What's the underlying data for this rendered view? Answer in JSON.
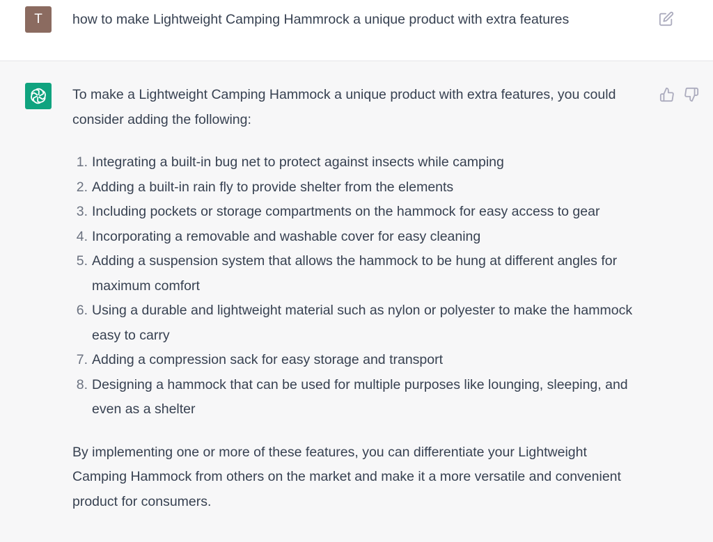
{
  "user_message": {
    "avatar_initial": "T",
    "text": "how to make Lightweight Camping Hammrock a unique product with extra features",
    "edit_icon": "edit-icon"
  },
  "assistant_message": {
    "avatar_icon": "openai-logo-icon",
    "intro": "To make a Lightweight Camping Hammock a unique product with extra features, you could consider adding the following:",
    "items": [
      {
        "number": "1.",
        "text": "Integrating a built-in bug net to protect against insects while camping"
      },
      {
        "number": "2.",
        "text": "Adding a built-in rain fly to provide shelter from the elements"
      },
      {
        "number": "3.",
        "text": "Including pockets or storage compartments on the hammock for easy access to gear"
      },
      {
        "number": "4.",
        "text": "Incorporating a removable and washable cover for easy cleaning"
      },
      {
        "number": "5.",
        "text": "Adding a suspension system that allows the hammock to be hung at different angles for maximum comfort"
      },
      {
        "number": "6.",
        "text": "Using a durable and lightweight material such as nylon or polyester to make the hammock easy to carry"
      },
      {
        "number": "7.",
        "text": "Adding a compression sack for easy storage and transport"
      },
      {
        "number": "8.",
        "text": "Designing a hammock that can be used for multiple purposes like lounging, sleeping, and even as a shelter"
      }
    ],
    "outro": "By implementing one or more of these features, you can differentiate your Lightweight Camping Hammock from others on the market and make it a more versatile and convenient product for consumers.",
    "feedback_icons": [
      "thumbs-up-icon",
      "thumbs-down-icon"
    ]
  },
  "colors": {
    "user_avatar": "#8b6b60",
    "assistant_avatar": "#10a37f",
    "assistant_background": "#f7f7f8",
    "text": "#374151"
  }
}
